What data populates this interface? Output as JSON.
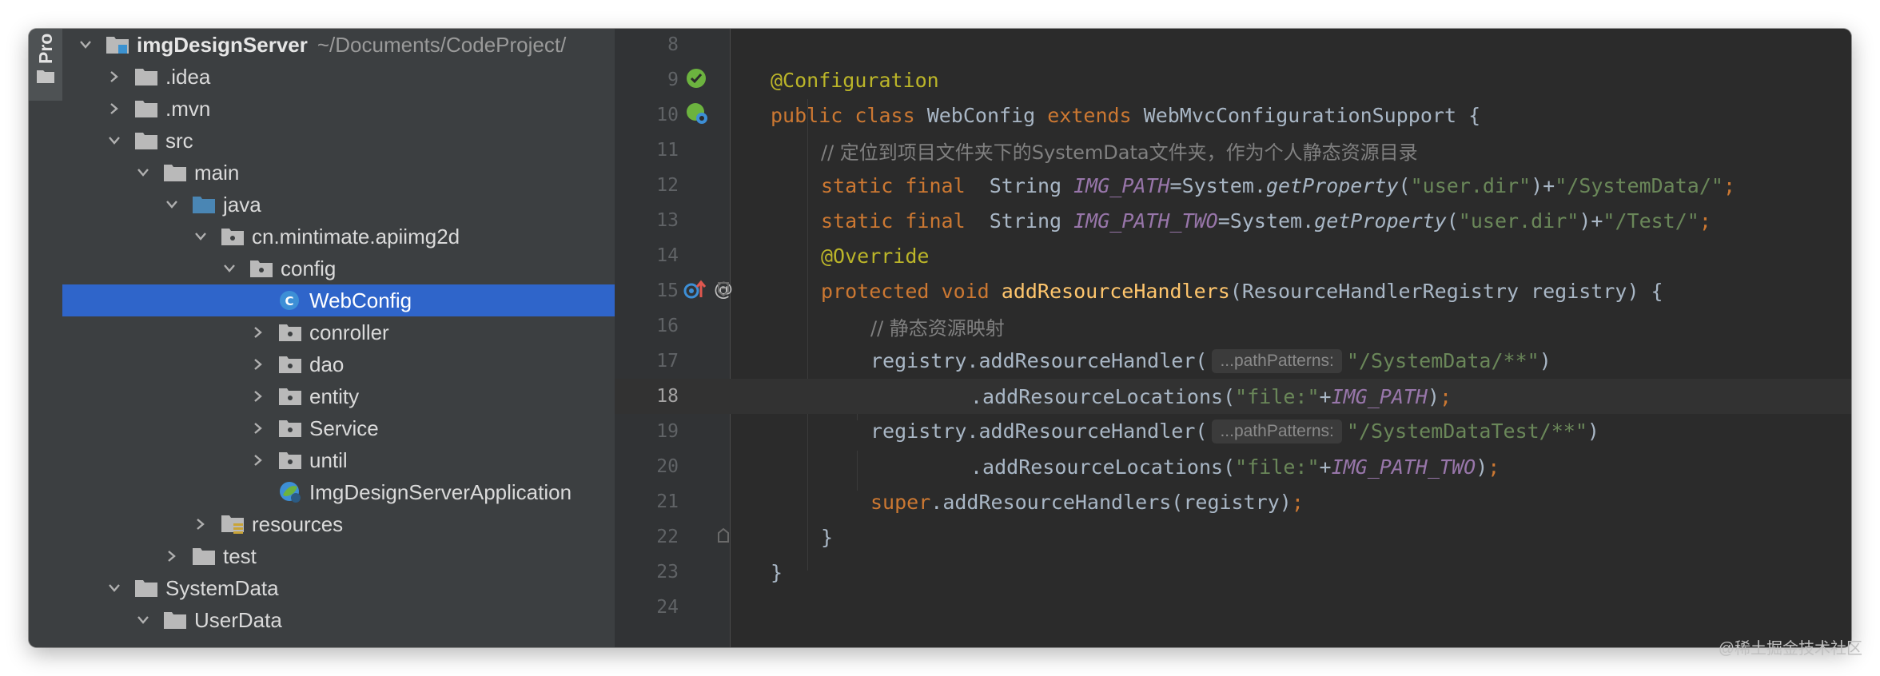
{
  "tool_window": {
    "label": "Pro"
  },
  "project": {
    "root": {
      "name": "imgDesignServer",
      "path": "~/Documents/CodeProject/"
    },
    "items": [
      {
        "label": ".idea"
      },
      {
        "label": ".mvn"
      },
      {
        "label": "src"
      },
      {
        "label": "main"
      },
      {
        "label": "java"
      },
      {
        "label": "cn.mintimate.apiimg2d"
      },
      {
        "label": "config"
      },
      {
        "label": "WebConfig"
      },
      {
        "label": "conroller"
      },
      {
        "label": "dao"
      },
      {
        "label": "entity"
      },
      {
        "label": "Service"
      },
      {
        "label": "until"
      },
      {
        "label": "ImgDesignServerApplication"
      },
      {
        "label": "resources"
      },
      {
        "label": "test"
      },
      {
        "label": "SystemData"
      },
      {
        "label": "UserData"
      }
    ]
  },
  "editor": {
    "line_numbers": [
      "8",
      "9",
      "10",
      "11",
      "12",
      "13",
      "14",
      "15",
      "16",
      "17",
      "18",
      "19",
      "20",
      "21",
      "22",
      "23",
      "24"
    ],
    "current_line": "18",
    "tokens": {
      "l9_ann": "@Configuration",
      "l10_kw1": "public",
      "l10_kw2": "class",
      "l10_cls": "WebConfig",
      "l10_kw3": "extends",
      "l10_sup": "WebMvcConfigurationSupport",
      "l10_brace": "{",
      "l11_cmt": "// 定位到项目文件夹下的SystemData文件夹，作为个人静态资源目录",
      "l12_kw": "static final",
      "l12_type": "String",
      "l12_const": "IMG_PATH",
      "l12_eq": "=System.",
      "l12_meth": "getProperty",
      "l12_open": "(",
      "l12_str1": "\"user.dir\"",
      "l12_mid": ")+",
      "l12_str2": "\"/SystemData/\"",
      "l12_end": ";",
      "l13_kw": "static final",
      "l13_type": "String",
      "l13_const": "IMG_PATH_TWO",
      "l13_eq": "=System.",
      "l13_meth": "getProperty",
      "l13_open": "(",
      "l13_str1": "\"user.dir\"",
      "l13_mid": ")+",
      "l13_str2": "\"/Test/\"",
      "l13_end": ";",
      "l14_ann": "@Override",
      "l15_kw": "protected void",
      "l15_meth": "addResourceHandlers",
      "l15_params": "(ResourceHandlerRegistry registry) {",
      "l16_cmt": "// 静态资源映射",
      "l17_call": "registry.addResourceHandler(",
      "l17_hint": "...pathPatterns:",
      "l17_str": "\"/SystemData/**\"",
      "l17_close": ")",
      "l18_call": ".addResourceLocations(",
      "l18_str": "\"file:\"",
      "l18_plus": "+",
      "l18_const": "IMG_PATH",
      "l18_close": ")",
      "l18_semi": ";",
      "l19_call": "registry.addResourceHandler(",
      "l19_hint": "...pathPatterns:",
      "l19_str": "\"/SystemDataTest/**\"",
      "l19_close": ")",
      "l20_call": ".addResourceLocations(",
      "l20_str": "\"file:\"",
      "l20_plus": "+",
      "l20_const": "IMG_PATH_TWO",
      "l20_close": ")",
      "l20_semi": ";",
      "l21_kw": "super",
      "l21_call": ".addResourceHandlers(registry)",
      "l21_semi": ";",
      "l22_brace": "}",
      "l23_brace": "}"
    }
  },
  "watermark": "@稀土掘金技术社区",
  "colors": {
    "keyword": "#cc7832",
    "annotation": "#bbb529",
    "string": "#6a8759",
    "comment": "#808080",
    "constant": "#9876aa",
    "method": "#ffc66d",
    "selection": "#2f65ca"
  }
}
